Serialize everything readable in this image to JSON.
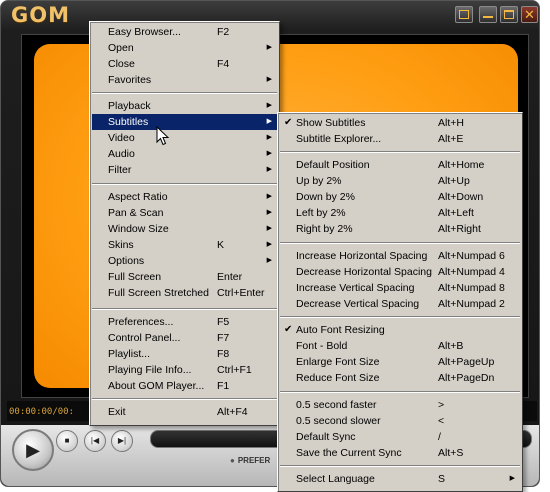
{
  "app": {
    "logo": "GOM"
  },
  "player": {
    "time": "00:00:00/00:",
    "pref_label": "PREFER"
  },
  "icons": {
    "play": "play-icon",
    "stop": "stop-icon",
    "prev": "prev-icon",
    "next": "next-icon",
    "cursor": "mouse-cursor-icon"
  },
  "colors": {
    "highlight": "#0a246a",
    "menu_bg": "#d4d0c8",
    "video_accent": "#ff9e12"
  },
  "main_menu": {
    "items": [
      {
        "label": "Easy Browser...",
        "shortcut": "F2",
        "submenu": false
      },
      {
        "label": "Open",
        "shortcut": "",
        "submenu": true
      },
      {
        "label": "Close",
        "shortcut": "F4",
        "submenu": false
      },
      {
        "label": "Favorites",
        "shortcut": "",
        "submenu": true
      },
      {
        "label": "Playback",
        "shortcut": "",
        "submenu": true
      },
      {
        "label": "Subtitles",
        "shortcut": "",
        "submenu": true,
        "highlighted": true
      },
      {
        "label": "Video",
        "shortcut": "",
        "submenu": true
      },
      {
        "label": "Audio",
        "shortcut": "",
        "submenu": true
      },
      {
        "label": "Filter",
        "shortcut": "",
        "submenu": true
      },
      {
        "label": "Aspect Ratio",
        "shortcut": "",
        "submenu": true
      },
      {
        "label": "Pan & Scan",
        "shortcut": "",
        "submenu": true
      },
      {
        "label": "Window Size",
        "shortcut": "",
        "submenu": true
      },
      {
        "label": "Skins",
        "shortcut": "K",
        "submenu": true
      },
      {
        "label": "Options",
        "shortcut": "",
        "submenu": true
      },
      {
        "label": "Full Screen",
        "shortcut": "Enter",
        "submenu": false
      },
      {
        "label": "Full Screen Stretched",
        "shortcut": "Ctrl+Enter",
        "submenu": false
      },
      {
        "label": "Preferences...",
        "shortcut": "F5",
        "submenu": false
      },
      {
        "label": "Control Panel...",
        "shortcut": "F7",
        "submenu": false
      },
      {
        "label": "Playlist...",
        "shortcut": "F8",
        "submenu": false
      },
      {
        "label": "Playing File Info...",
        "shortcut": "Ctrl+F1",
        "submenu": false
      },
      {
        "label": "About GOM Player...",
        "shortcut": "F1",
        "submenu": false
      },
      {
        "label": "Exit",
        "shortcut": "Alt+F4",
        "submenu": false
      }
    ]
  },
  "subtitle_menu": {
    "items": [
      {
        "label": "Show Subtitles",
        "shortcut": "Alt+H",
        "checked": true
      },
      {
        "label": "Subtitle Explorer...",
        "shortcut": "Alt+E"
      },
      {
        "label": "Default Position",
        "shortcut": "Alt+Home"
      },
      {
        "label": "Up by 2%",
        "shortcut": "Alt+Up"
      },
      {
        "label": "Down by 2%",
        "shortcut": "Alt+Down"
      },
      {
        "label": "Left by 2%",
        "shortcut": "Alt+Left"
      },
      {
        "label": "Right by 2%",
        "shortcut": "Alt+Right"
      },
      {
        "label": "Increase Horizontal Spacing",
        "shortcut": "Alt+Numpad 6"
      },
      {
        "label": "Decrease Horizontal Spacing",
        "shortcut": "Alt+Numpad 4"
      },
      {
        "label": "Increase Vertical Spacing",
        "shortcut": "Alt+Numpad 8"
      },
      {
        "label": "Decrease Vertical Spacing",
        "shortcut": "Alt+Numpad 2"
      },
      {
        "label": "Auto Font Resizing",
        "shortcut": "",
        "checked": true
      },
      {
        "label": "Font - Bold",
        "shortcut": "Alt+B"
      },
      {
        "label": "Enlarge Font Size",
        "shortcut": "Alt+PageUp"
      },
      {
        "label": "Reduce Font Size",
        "shortcut": "Alt+PageDn"
      },
      {
        "label": "0.5 second faster",
        "shortcut": ">"
      },
      {
        "label": "0.5 second slower",
        "shortcut": "<"
      },
      {
        "label": "Default Sync",
        "shortcut": "/"
      },
      {
        "label": "Save the Current Sync",
        "shortcut": "Alt+S"
      },
      {
        "label": "Select Language",
        "shortcut": "S",
        "submenu": true
      }
    ]
  }
}
